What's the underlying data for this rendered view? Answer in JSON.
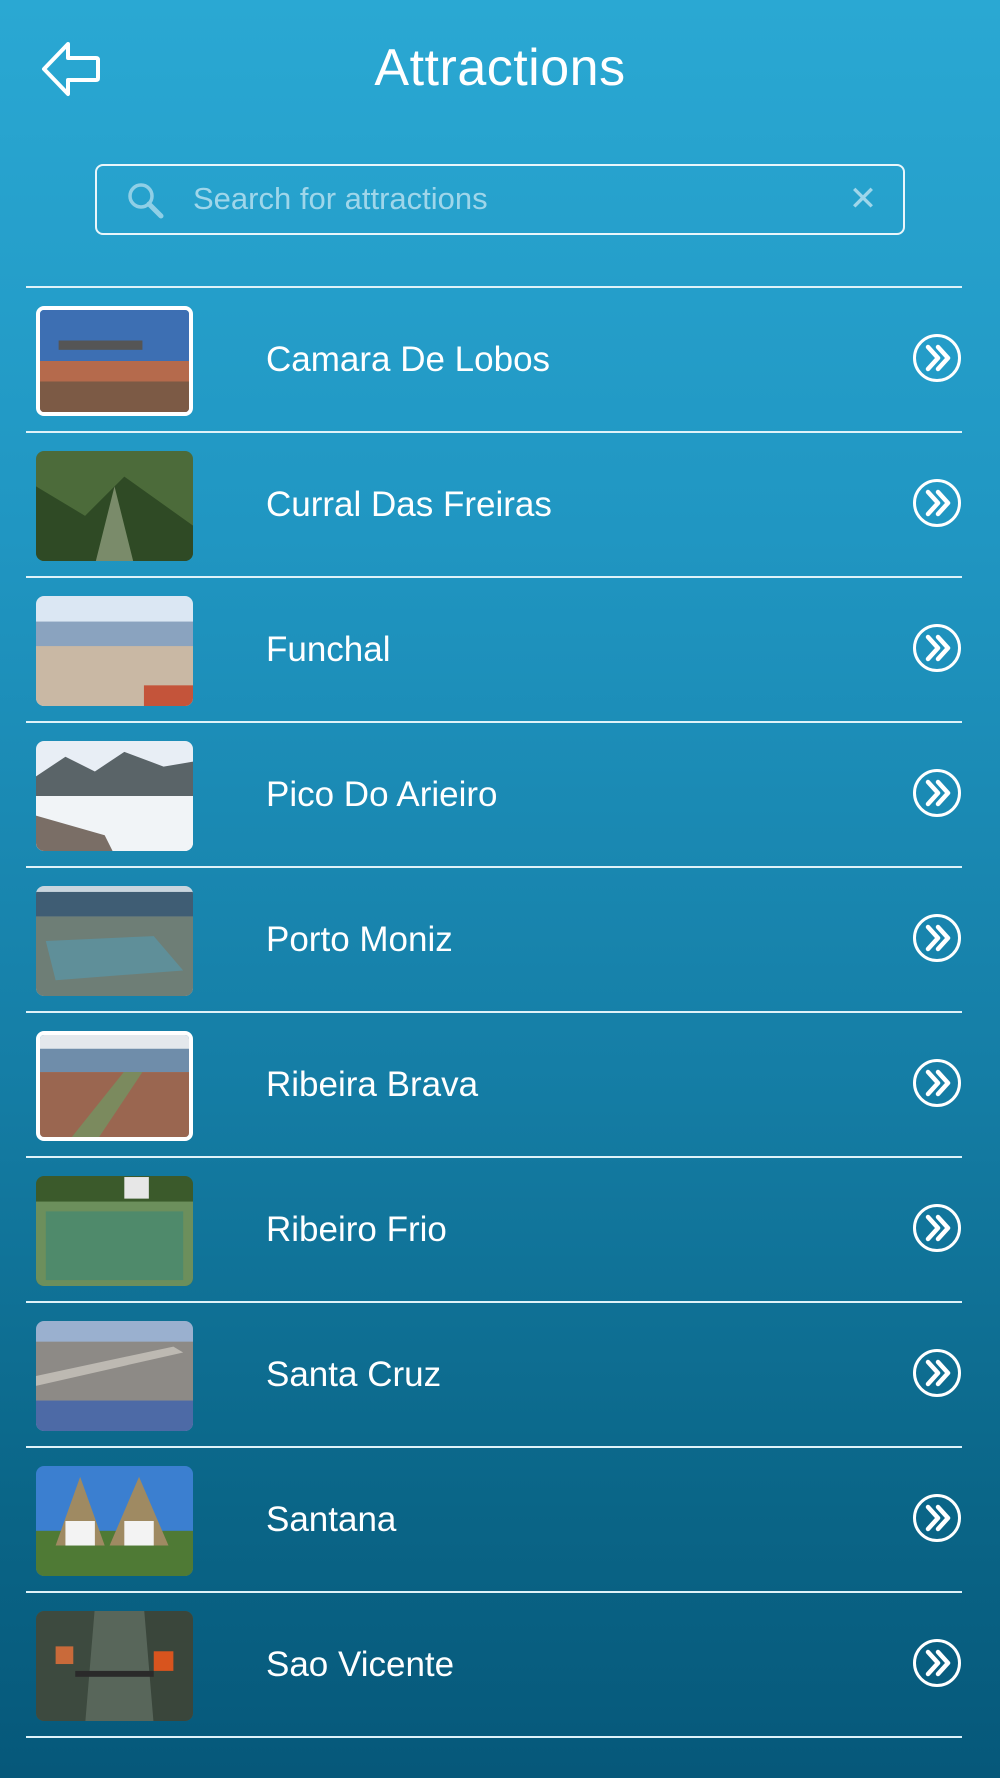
{
  "header": {
    "title": "Attractions",
    "back_icon": "back-arrow-icon"
  },
  "search": {
    "placeholder": "Search for attractions",
    "value": "",
    "icon": "search-icon",
    "clear_icon": "clear-icon"
  },
  "items": [
    {
      "label": "Camara De Lobos",
      "thumb": "harbour-photo",
      "framed": true
    },
    {
      "label": "Curral Das Freiras",
      "thumb": "valley-photo",
      "framed": false
    },
    {
      "label": "Funchal",
      "thumb": "city-photo",
      "framed": false
    },
    {
      "label": "Pico Do Arieiro",
      "thumb": "peak-photo",
      "framed": false
    },
    {
      "label": "Porto Moniz",
      "thumb": "pools-photo",
      "framed": false
    },
    {
      "label": "Ribeira Brava",
      "thumb": "town-photo",
      "framed": true
    },
    {
      "label": "Ribeiro Frio",
      "thumb": "tank-photo",
      "framed": false
    },
    {
      "label": "Santa Cruz",
      "thumb": "airport-photo",
      "framed": false
    },
    {
      "label": "Santana",
      "thumb": "houses-photo",
      "framed": false
    },
    {
      "label": "Sao Vicente",
      "thumb": "cablecar-photo",
      "framed": false
    }
  ],
  "row_icon": "double-chevron-right-icon",
  "colors": {
    "background_top": "#2aa8d3",
    "background_bottom": "#06587a",
    "text": "#ffffff",
    "placeholder": "#9fd6ea"
  }
}
